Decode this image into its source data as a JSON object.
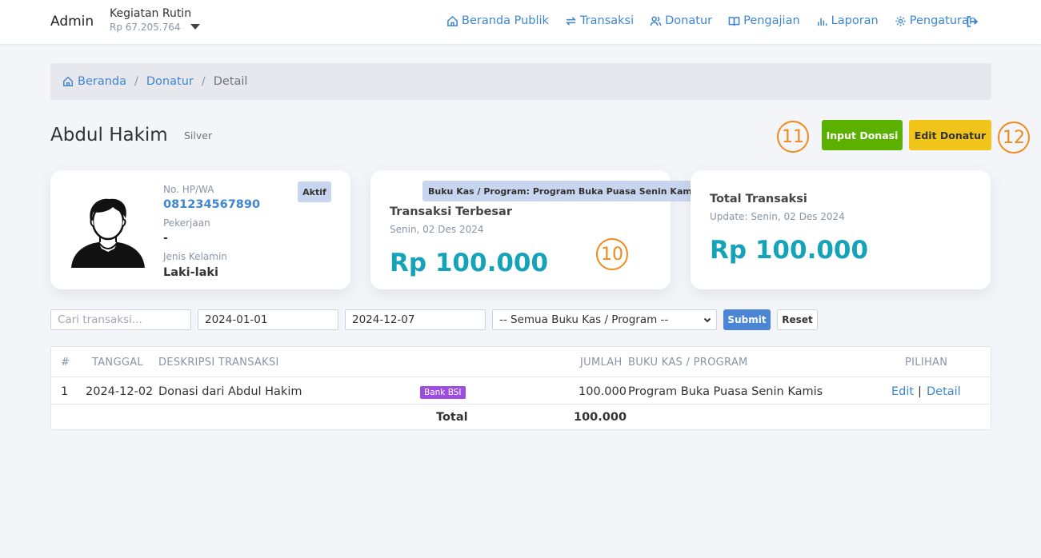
{
  "navbar": {
    "brand": "Admin",
    "kas_title": "Kegiatan Rutin",
    "kas_balance": "Rp 67.205.764",
    "links": [
      {
        "label": "Beranda Publik",
        "icon": "home-icon"
      },
      {
        "label": "Transaksi",
        "icon": "repeat-icon"
      },
      {
        "label": "Donatur",
        "icon": "users-icon"
      },
      {
        "label": "Pengajian",
        "icon": "book-icon"
      },
      {
        "label": "Laporan",
        "icon": "bar-chart-icon"
      },
      {
        "label": "Pengaturan",
        "icon": "gear-icon"
      }
    ],
    "logout_icon": "logout-icon"
  },
  "breadcrumb": {
    "home": "Beranda",
    "donatur": "Donatur",
    "current": "Detail",
    "separator": "/"
  },
  "donor": {
    "name": "Abdul Hakim",
    "level": "Silver",
    "status": "Aktif",
    "phone_label": "No. HP/WA",
    "phone": "081234567890",
    "job_label": "Pekerjaan",
    "job": "-",
    "gender_label": "Jenis Kelamin",
    "gender": "Laki-laki"
  },
  "actions": {
    "input_donasi": "Input Donasi",
    "edit_donatur": "Edit Donatur"
  },
  "markers": {
    "m10": "10",
    "m11": "11",
    "m12": "12"
  },
  "largest": {
    "program_badge": "Buku Kas / Program: Program Buka Puasa Senin Kamis",
    "title": "Transaksi Terbesar",
    "date": "Senin, 02 Des 2024",
    "amount": "Rp 100.000"
  },
  "total": {
    "title": "Total Transaksi",
    "update": "Update: Senin, 02 Des 2024",
    "amount": "Rp 100.000"
  },
  "filters": {
    "search_placeholder": "Cari transaksi...",
    "date_from": "2024-01-01",
    "date_to": "2024-12-07",
    "program_select": "-- Semua Buku Kas / Program --",
    "submit": "Submit",
    "reset": "Reset"
  },
  "table": {
    "headers": {
      "no": "#",
      "tanggal": "TANGGAL",
      "deskripsi": "DESKRIPSI TRANSAKSI",
      "jumlah": "JUMLAH",
      "program": "BUKU KAS / PROGRAM",
      "pilihan": "PILIHAN"
    },
    "rows": [
      {
        "no": "1",
        "tanggal": "2024-12-02",
        "deskripsi": "Donasi dari Abdul Hakim",
        "bank": "Bank BSI",
        "jumlah": "100.000",
        "program": "Program Buka Puasa Senin Kamis",
        "edit": "Edit",
        "sep": "|",
        "detail": "Detail"
      }
    ],
    "total_label": "Total",
    "total_value": "100.000"
  }
}
